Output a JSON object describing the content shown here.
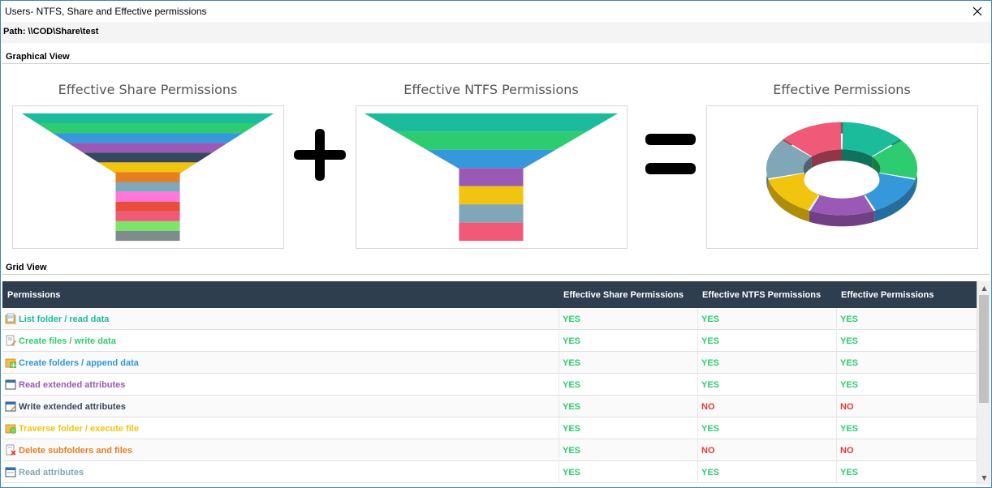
{
  "window": {
    "title": "Users- NTFS, Share and Effective permissions",
    "path": "Path: \\\\COD\\Share\\test"
  },
  "sections": {
    "graphical": "Graphical View",
    "grid": "Grid View"
  },
  "charts": {
    "share_title": "Effective Share Permissions",
    "ntfs_title": "Effective NTFS Permissions",
    "effective_title": "Effective Permissions",
    "share_funnel_colors": [
      "#1abc9c",
      "#2ecc71",
      "#3498db",
      "#9b59b6",
      "#34495e",
      "#f1c40f",
      "#e67e22",
      "#7fa7b8",
      "#ff77d8",
      "#e74c3c",
      "#f05a78",
      "#7ee36a",
      "#7f8c8d"
    ],
    "ntfs_funnel_colors": [
      "#1abc9c",
      "#2ecc71",
      "#3498db",
      "#9b59b6",
      "#f1c40f",
      "#7fa7b8",
      "#f05a78"
    ],
    "donut_colors": [
      "#1abc9c",
      "#2ecc71",
      "#3498db",
      "#9b59b6",
      "#f1c40f",
      "#7fa7b8",
      "#f05a78"
    ],
    "operators": {
      "plus": "plus-icon",
      "equals": "equals-icon"
    }
  },
  "grid": {
    "headers": [
      "Permissions",
      "Effective Share Permissions",
      "Effective NTFS Permissions",
      "Effective Permissions"
    ],
    "rows": [
      {
        "permission": "List folder / read data",
        "color": "#1abc9c",
        "icon": "folder-list-icon",
        "share": "YES",
        "ntfs": "YES",
        "effective": "YES"
      },
      {
        "permission": "Create files / write data",
        "color": "#2ecc71",
        "icon": "file-write-icon",
        "share": "YES",
        "ntfs": "YES",
        "effective": "YES"
      },
      {
        "permission": "Create folders / append data",
        "color": "#3498db",
        "icon": "folder-add-icon",
        "share": "YES",
        "ntfs": "YES",
        "effective": "YES"
      },
      {
        "permission": "Read extended attributes",
        "color": "#9b59b6",
        "icon": "window-read-icon",
        "share": "YES",
        "ntfs": "YES",
        "effective": "YES"
      },
      {
        "permission": "Write extended attributes",
        "color": "#34495e",
        "icon": "window-write-icon",
        "share": "YES",
        "ntfs": "NO",
        "effective": "NO"
      },
      {
        "permission": "Traverse folder / execute file",
        "color": "#f1c40f",
        "icon": "folder-execute-icon",
        "share": "YES",
        "ntfs": "YES",
        "effective": "YES"
      },
      {
        "permission": "Delete subfolders and files",
        "color": "#e67e22",
        "icon": "file-delete-icon",
        "share": "YES",
        "ntfs": "NO",
        "effective": "NO"
      },
      {
        "permission": "Read attributes",
        "color": "#7fa7b8",
        "icon": "window-attributes-icon",
        "share": "YES",
        "ntfs": "YES",
        "effective": "YES"
      }
    ],
    "yes_color": "#2ecc71",
    "no_color": "#e53935"
  }
}
